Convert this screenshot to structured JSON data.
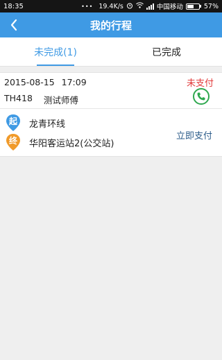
{
  "statusbar": {
    "time": "18:35",
    "dots": "•••",
    "network_speed": "19.4K/s",
    "carrier": "中国移动",
    "battery": "57%",
    "battery_level": 0.57
  },
  "header": {
    "title": "我的行程"
  },
  "tabs": [
    {
      "label": "未完成(1)"
    },
    {
      "label": "已完成"
    }
  ],
  "trip": {
    "date": "2015-08-15",
    "time": "17:09",
    "vehicle": "TH418",
    "driver": "测试师傅",
    "status": "未支付",
    "from_badge": "起",
    "to_badge": "终",
    "from": "龙青环线",
    "to": "华阳客运站2(公交站)",
    "pay_label": "立即支付"
  },
  "colors": {
    "accent": "#3f9ae4",
    "status_red": "#e23b3b",
    "phone_green": "#2fa84f",
    "from_pin": "#3f9ae4",
    "to_pin": "#f09a2a"
  }
}
